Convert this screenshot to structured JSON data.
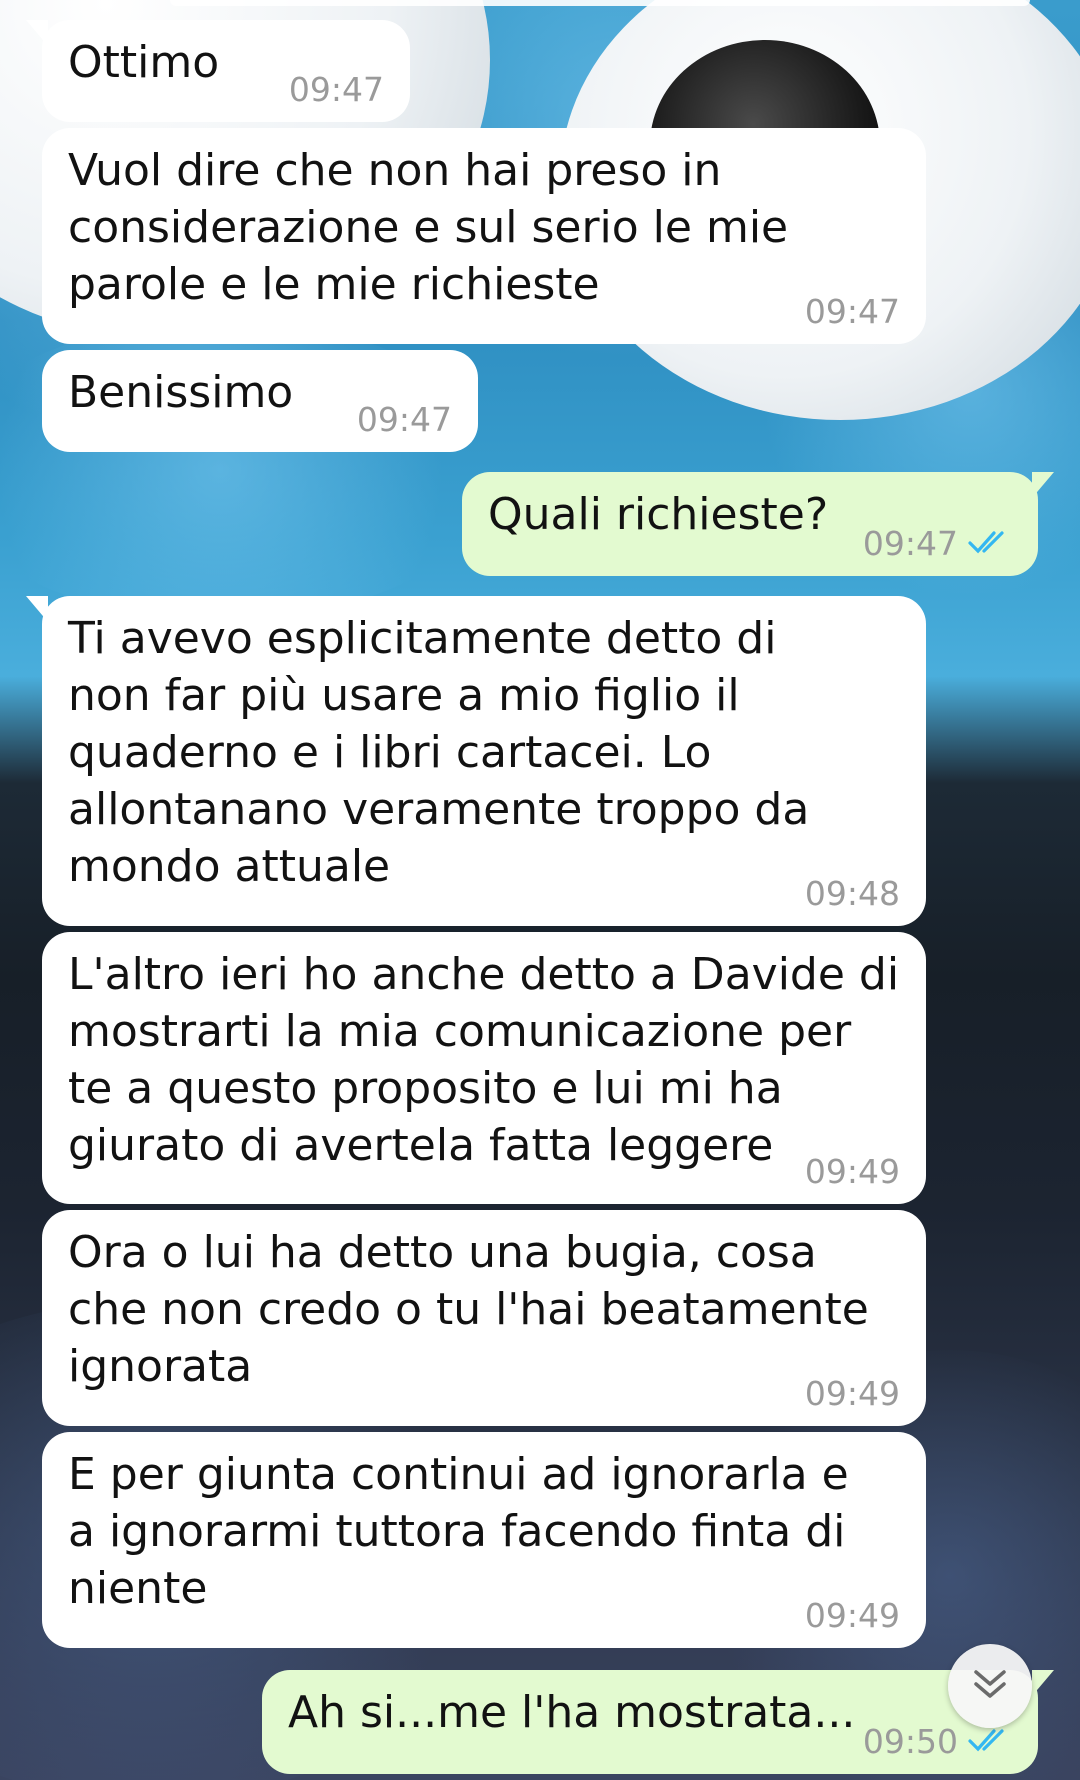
{
  "colors": {
    "incoming_bubble": "#ffffff",
    "outgoing_bubble": "#e3fad0",
    "timestamp": "#9a9a9a",
    "read_ticks": "#34b7f1"
  },
  "messages": [
    {
      "direction": "in",
      "text": "Ottimo",
      "time": "09:47"
    },
    {
      "direction": "in",
      "text": "Vuol dire che non hai preso in considerazione e sul serio le mie parole e le mie richieste",
      "time": "09:47"
    },
    {
      "direction": "in",
      "text": "Benissimo",
      "time": "09:47"
    },
    {
      "direction": "out",
      "text": "Quali richieste?",
      "time": "09:47",
      "status": "read"
    },
    {
      "direction": "in",
      "text": "Ti avevo esplicitamente detto di non far più usare a mio figlio il quaderno e i libri cartacei. Lo allontanano veramente troppo da mondo attuale",
      "time": "09:48"
    },
    {
      "direction": "in",
      "text": "L'altro ieri ho anche detto a Davide di mostrarti la mia comunicazione per te a questo proposito e lui mi ha giurato di avertela fatta leggere",
      "time": "09:49"
    },
    {
      "direction": "in",
      "text": "Ora o lui ha detto una bugia, cosa che non credo o tu l'hai beatamente ignorata",
      "time": "09:49"
    },
    {
      "direction": "in",
      "text": "E per giunta continui ad ignorarla e a ignorarmi tuttora facendo finta di niente",
      "time": "09:49"
    },
    {
      "direction": "out",
      "text": "Ah si...me l'ha mostrata...",
      "time": "09:50",
      "status": "read"
    }
  ],
  "icons": {
    "read_receipt": "double-check-icon",
    "scroll_down": "double-chevron-down-icon"
  }
}
